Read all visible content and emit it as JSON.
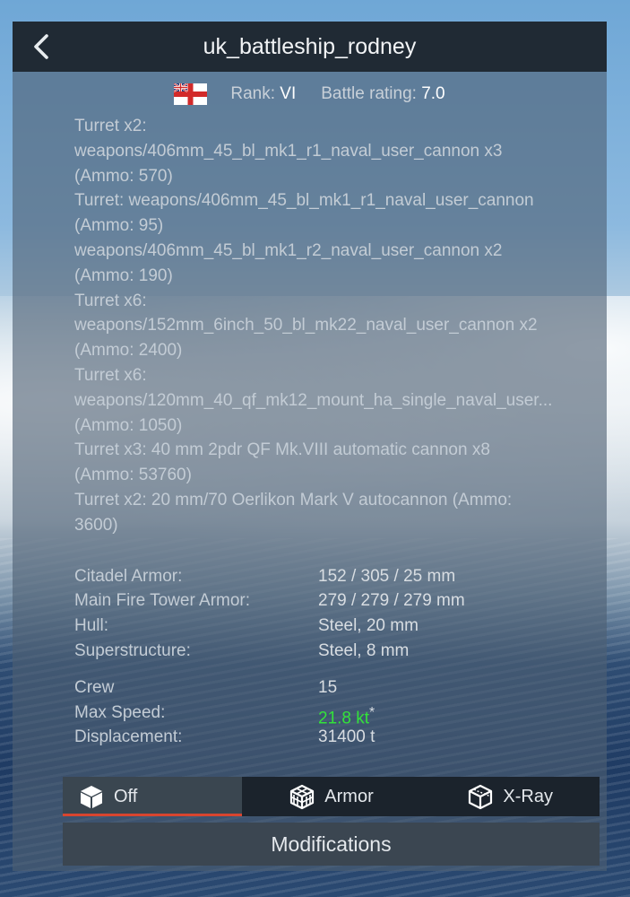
{
  "header": {
    "title": "uk_battleship_rodney",
    "back_icon": "chevron-left-icon"
  },
  "info": {
    "flag_icon": "uk-naval-ensign-flag-icon",
    "rank_label": "Rank:",
    "rank_value": "VI",
    "br_label": "Battle rating:",
    "br_value": "7.0"
  },
  "weapons": [
    "Turret x2:",
    "weapons/406mm_45_bl_mk1_r1_naval_user_cannon x3",
    "(Ammo: 570)",
    "Turret: weapons/406mm_45_bl_mk1_r1_naval_user_cannon",
    "(Ammo: 95)",
    "weapons/406mm_45_bl_mk1_r2_naval_user_cannon x2",
    "(Ammo: 190)",
    "Turret x6:",
    "weapons/152mm_6inch_50_bl_mk22_naval_user_cannon x2",
    "(Ammo: 2400)",
    "Turret x6:",
    "weapons/120mm_40_qf_mk12_mount_ha_single_naval_user...",
    "(Ammo: 1050)",
    "Turret x3: 40 mm 2pdr QF Mk.VIII automatic cannon x8",
    "(Ammo: 53760)",
    "Turret x2: 20 mm/70 Oerlikon Mark V autocannon (Ammo:",
    "3600)"
  ],
  "armor": [
    {
      "label": "Citadel Armor:",
      "value": "152 / 305 / 25 mm"
    },
    {
      "label": "Main Fire Tower Armor:",
      "value": "279 / 279 / 279 mm"
    },
    {
      "label": "Hull:",
      "value": "Steel, 20 mm"
    },
    {
      "label": "Superstructure:",
      "value": "Steel, 8 mm"
    }
  ],
  "specs": {
    "crew_label": "Crew",
    "crew_value": "15",
    "speed_label": "Max Speed:",
    "speed_value": "21.8 kt",
    "speed_mark": "*",
    "displacement_label": "Displacement:",
    "displacement_value": "31400 t"
  },
  "modes": [
    {
      "label": "Off",
      "icon": "cube-icon",
      "active": true
    },
    {
      "label": "Armor",
      "icon": "armor-cube-icon",
      "active": false
    },
    {
      "label": "X-Ray",
      "icon": "xray-cube-icon",
      "active": false
    }
  ],
  "modifications_label": "Modifications",
  "colors": {
    "speed": "#33e23a",
    "active_underline": "#d8452f",
    "titlebar": "#202a34"
  }
}
